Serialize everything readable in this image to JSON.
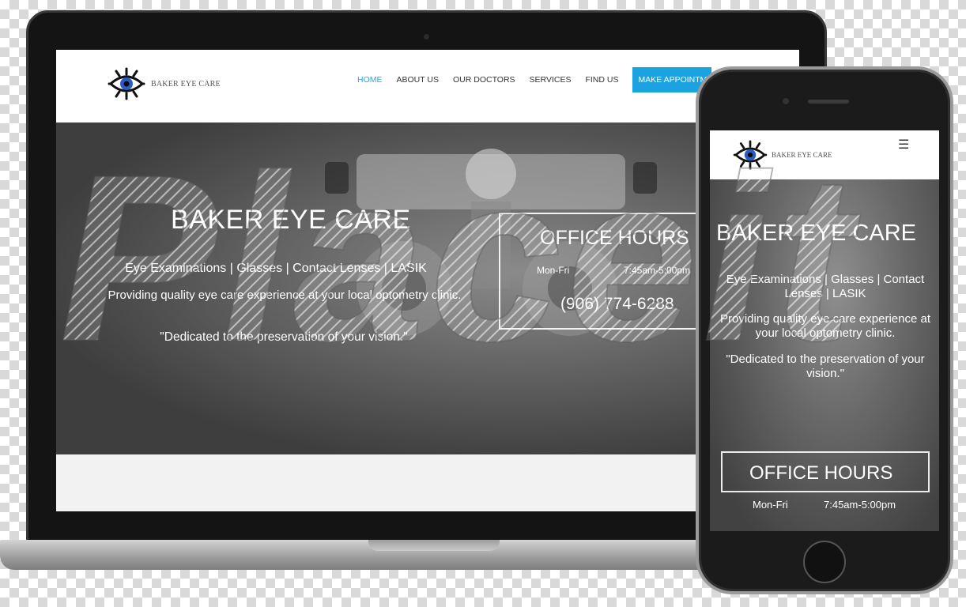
{
  "site": {
    "logo_text": "BAKER EYE CARE",
    "nav": [
      {
        "label": "HOME",
        "active": true
      },
      {
        "label": "ABOUT US"
      },
      {
        "label": "OUR DOCTORS"
      },
      {
        "label": "SERVICES"
      },
      {
        "label": "FIND US"
      }
    ],
    "cta_label": "MAKE APPOINTMENT",
    "hero": {
      "title": "BAKER EYE CARE",
      "subtitle": "Eye Examinations | Glasses | Contact Lenses | LASIK",
      "description": "Providing quality eye care experience at your local optometry clinic.",
      "quote": "\"Dedicated to the preservation of your vision.\""
    },
    "office_hours": {
      "title": "OFFICE HOURS",
      "days": "Mon-Fri",
      "time": "7:45am-5:00pm",
      "phone": "(906) 774-6288"
    },
    "menu_icon": "☰"
  },
  "colors": {
    "nav_active": "#29a6e0",
    "cta_background": "#1aa3e0",
    "logo_iris": "#2b5cc4"
  },
  "watermark_text": "Placeit"
}
